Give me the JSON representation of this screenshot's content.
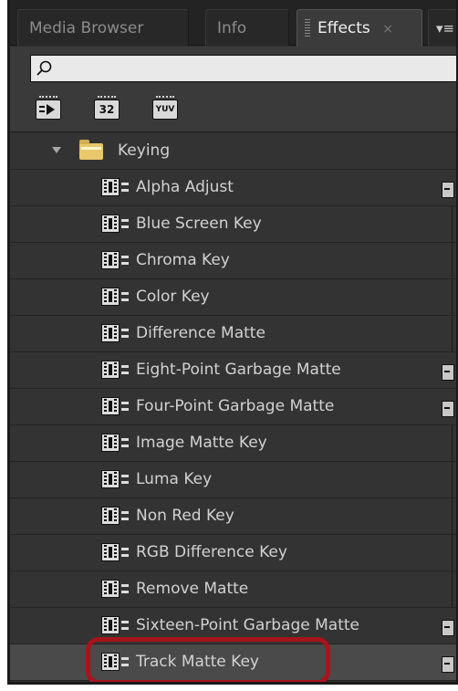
{
  "tabs": {
    "media_browser": "Media Browser",
    "info": "Info",
    "effects": "Effects",
    "effects_close": "×",
    "menu": "▾≡"
  },
  "search": {
    "value": "",
    "placeholder": ""
  },
  "filters": [
    {
      "icon": "accelerated-effects-icon",
      "label": ""
    },
    {
      "icon": "32-bit-color-icon",
      "label": "32"
    },
    {
      "icon": "yuv-effects-icon",
      "label": "YUV"
    }
  ],
  "tree": {
    "folder": "Keying",
    "items": [
      {
        "label": "Alpha Adjust",
        "accelerated": true
      },
      {
        "label": "Blue Screen Key",
        "accelerated": false
      },
      {
        "label": "Chroma Key",
        "accelerated": false
      },
      {
        "label": "Color Key",
        "accelerated": false
      },
      {
        "label": "Difference Matte",
        "accelerated": false
      },
      {
        "label": "Eight-Point Garbage Matte",
        "accelerated": true
      },
      {
        "label": "Four-Point Garbage Matte",
        "accelerated": true
      },
      {
        "label": "Image Matte Key",
        "accelerated": false
      },
      {
        "label": "Luma Key",
        "accelerated": false
      },
      {
        "label": "Non Red Key",
        "accelerated": false
      },
      {
        "label": "RGB Difference Key",
        "accelerated": false
      },
      {
        "label": "Remove Matte",
        "accelerated": false
      },
      {
        "label": "Sixteen-Point Garbage Matte",
        "accelerated": true
      },
      {
        "label": "Track Matte Key",
        "accelerated": true,
        "selected": true
      }
    ]
  },
  "colors": {
    "highlight_ring": "#a8131c",
    "folder": "#e8c86b",
    "panel_bg": "#333333"
  }
}
